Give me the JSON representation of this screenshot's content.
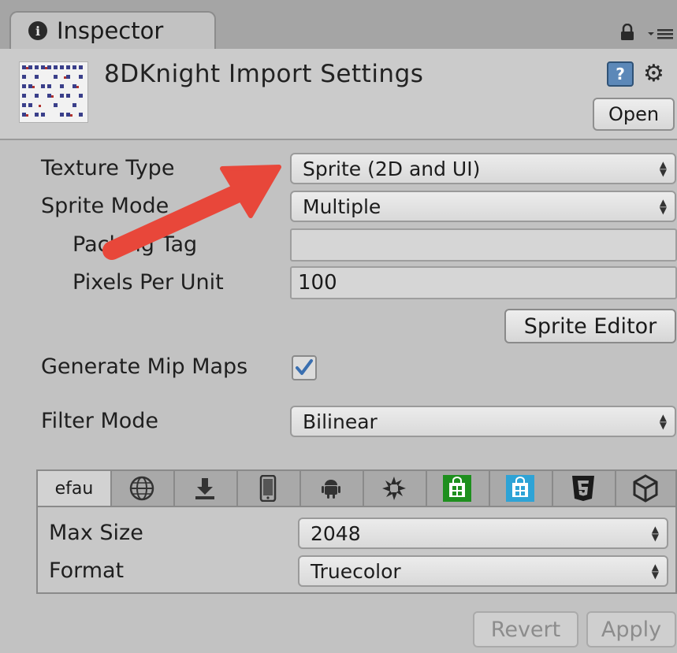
{
  "tab": {
    "title": "Inspector"
  },
  "header": {
    "title": "8DKnight Import Settings",
    "open_label": "Open"
  },
  "properties": {
    "texture_type": {
      "label": "Texture Type",
      "value": "Sprite (2D and UI)"
    },
    "sprite_mode": {
      "label": "Sprite Mode",
      "value": "Multiple"
    },
    "packing_tag": {
      "label": "Packing Tag",
      "value": ""
    },
    "pixels_per_unit": {
      "label": "Pixels Per Unit",
      "value": "100"
    },
    "sprite_editor_label": "Sprite Editor",
    "generate_mip_maps": {
      "label": "Generate Mip Maps",
      "checked": true
    },
    "filter_mode": {
      "label": "Filter Mode",
      "value": "Bilinear"
    }
  },
  "platform": {
    "tabs": [
      {
        "label": "efau",
        "icon": "default-tab"
      },
      {
        "icon": "globe-icon"
      },
      {
        "icon": "download-icon"
      },
      {
        "icon": "phone-icon"
      },
      {
        "icon": "android-icon"
      },
      {
        "icon": "blackberry-icon"
      },
      {
        "icon": "windows-store-green-icon",
        "color": "#1e8f1e"
      },
      {
        "icon": "windows-store-blue-icon",
        "color": "#2ea3d6"
      },
      {
        "icon": "html5-icon"
      },
      {
        "icon": "unity-cube-icon"
      }
    ],
    "max_size": {
      "label": "Max Size",
      "value": "2048"
    },
    "format": {
      "label": "Format",
      "value": "Truecolor"
    }
  },
  "footer": {
    "revert_label": "Revert",
    "apply_label": "Apply"
  },
  "colors": {
    "annotation_arrow": "#e8473a",
    "checkbox_check": "#3a6fb0"
  }
}
